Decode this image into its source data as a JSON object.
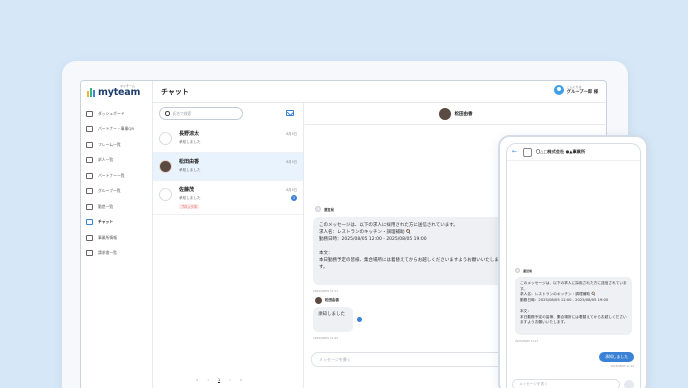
{
  "app": {
    "logo": "myteam",
    "logo_sup": "マイチーム",
    "page_title": "チャット"
  },
  "user": {
    "greeting": "こんにちは",
    "name": "グループ一郎 様"
  },
  "sidebar": {
    "items": [
      {
        "label": "ダッシュボード",
        "icon": "dashboard-icon"
      },
      {
        "label": "パートナー・事業QR",
        "icon": "qr-icon"
      },
      {
        "label": "フレーム一覧",
        "icon": "frame-icon"
      },
      {
        "label": "求人一覧",
        "icon": "job-icon"
      },
      {
        "label": "パートナー一覧",
        "icon": "partner-icon"
      },
      {
        "label": "グループ一覧",
        "icon": "group-icon"
      },
      {
        "label": "勤怠一覧",
        "icon": "attendance-icon"
      },
      {
        "label": "チャット",
        "icon": "chat-icon",
        "active": true
      },
      {
        "label": "事業所情報",
        "icon": "office-icon"
      },
      {
        "label": "請求書一覧",
        "icon": "invoice-icon"
      }
    ]
  },
  "search": {
    "placeholder": "氏名で検索"
  },
  "conversations": [
    {
      "name": "長野涼太",
      "message": "承知しました",
      "date": "8月5日",
      "unread": ""
    },
    {
      "name": "松田由香",
      "message": "承知しました",
      "date": "8月5日",
      "unread": ""
    },
    {
      "name": "佐藤茂",
      "message": "承知しました",
      "date": "8月5日",
      "unread": "2",
      "badge": "ブロック中"
    }
  ],
  "pager": {
    "first": "«",
    "prev": "‹",
    "current": "1",
    "next": "›",
    "last": "»"
  },
  "chat": {
    "partner_name": "松田由香",
    "system_sender": "運営局",
    "system_message": "このメッセージは、以下の求人に採用された方に送信されています。\n求人名：レストランのキッチン・調理補助 🍳\n勤務日時：2025/08/05 12:00 - 2025/08/05 19:00\n\n本文：\n本日勤務予定の皆様、集合場所には着替えてからお越しくださいますようお願いいたします。",
    "system_time": "2025/08/05 11:17",
    "reply_sender": "松田由香",
    "reply_message": "承知しました",
    "reply_read": "既",
    "reply_time": "2025/08/05 11:22",
    "composer_placeholder": "メッセージを書く"
  },
  "phone": {
    "back": "←",
    "title": "〇△□株式会社 ●▲事業所",
    "sender": "運営局",
    "message": "このメッセージは、以下の求人に採用された方に送信されています。\n求人名：レストランのキッチン・調理補助 🍳\n勤務日時：2025/08/05 12:00 - 2025/08/05 19:00\n\n本文：\n本日勤務予定の皆様、集合場所には着替えてからお越しくださいますようお願いいたします。",
    "time": "2025/08/05 11:17",
    "sent_message": "承知しました",
    "sent_time": "2025/08/05 11:22",
    "composer_placeholder": "メッセージを書く"
  },
  "colors": {
    "background": "#d6e8f8",
    "accent": "#3b82d6",
    "selected_row": "#e9f3fd",
    "block_badge": "#e05656"
  }
}
